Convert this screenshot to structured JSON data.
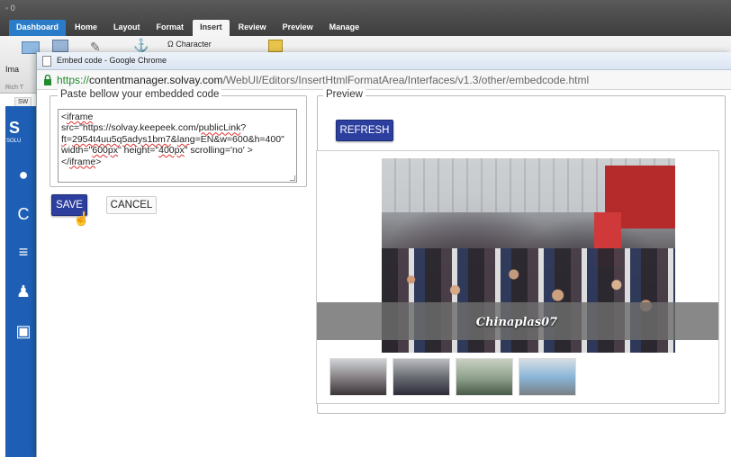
{
  "app": {
    "ribbon_tabs": [
      "Dashboard",
      "Home",
      "Layout",
      "Format",
      "Insert",
      "Review",
      "Preview",
      "Manage"
    ],
    "ribbon_items": {
      "image_label": "Ima",
      "character_label": "Ω Character"
    },
    "ribbon_group_label": "Rich T",
    "tab_label": "SW",
    "logo_text": "S",
    "logo_sub": "SOLU"
  },
  "dialog": {
    "window_title": "Embed code - Google Chrome",
    "url": {
      "scheme": "https://",
      "host": "contentmanager.solvay.com",
      "path": "/WebUI/Editors/InsertHtmlFormatArea/Interfaces/v1.3/other/embedcode.html"
    },
    "code_legend": "Paste bellow your embedded code",
    "code_parts": {
      "p1": "<",
      "w1": "iframe",
      "p2": "src=\"https://solvay.keepeek.com/",
      "w2": "publicLink",
      "p3": "?",
      "w3": "ft",
      "p4": "=",
      "w4": "2954t4uu5q5adys1bm7",
      "p5": "&",
      "w5": "lang",
      "p6": "=EN&w=600&h=400\" width=\"",
      "w6": "600px",
      "p7": "\" height=\"",
      "w7": "400px",
      "p8": "\" scrolling='no' >",
      "p9": "</",
      "w9": "iframe",
      "p10": ">"
    },
    "save_label": "SAVE",
    "cancel_label": "CANCEL",
    "preview_legend": "Preview",
    "refresh_label": "REFRESH",
    "caption": "Chinaplas07",
    "colors": {
      "primary_button": "#2d3f9e",
      "https_green": "#1f8a2e",
      "app_blue": "#1e5fb5"
    }
  }
}
